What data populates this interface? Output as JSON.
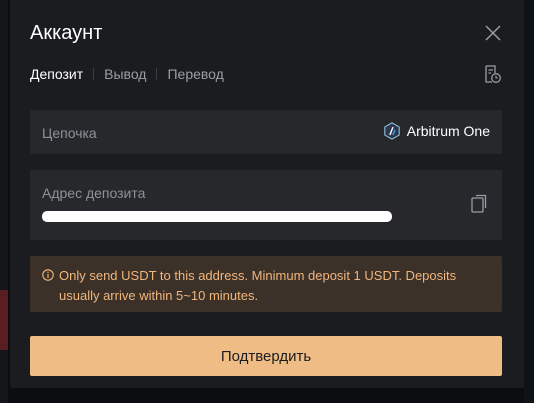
{
  "modal": {
    "title": "Аккаунт",
    "close_icon": "close-icon"
  },
  "tabs": [
    {
      "label": "Депозит",
      "active": true
    },
    {
      "label": "Вывод",
      "active": false
    },
    {
      "label": "Перевод",
      "active": false
    }
  ],
  "history_icon": "history-icon",
  "chain": {
    "label": "Цепочка",
    "value": "Arbitrum One",
    "icon": "arbitrum-icon"
  },
  "address": {
    "label": "Адрес депозита",
    "value": "",
    "copy_icon": "copy-icon"
  },
  "notice": {
    "icon": "info-icon",
    "text": "Only send USDT to this address. Minimum deposit 1 USDT. Deposits usually arrive within 5~10 minutes."
  },
  "confirm_label": "Подтвердить",
  "colors": {
    "accent": "#f0bc86",
    "notice_bg": "#3b3129",
    "notice_text": "#f2b57c",
    "modal_bg": "#1a1c1f",
    "field_bg": "#26282c"
  }
}
